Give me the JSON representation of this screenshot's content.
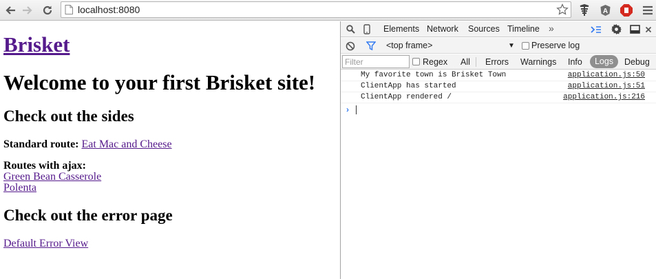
{
  "browser": {
    "url": "localhost:8080",
    "icons": [
      "back-icon",
      "forward-icon",
      "reload-icon",
      "page-icon",
      "star-icon",
      "extension-signal-icon",
      "extension-a-icon",
      "extension-stop-icon",
      "menu-icon"
    ]
  },
  "page": {
    "site_title": "Brisket",
    "welcome_heading": "Welcome to your first Brisket site!",
    "sides_heading": "Check out the sides",
    "standard_route_label": "Standard route:",
    "standard_route_link": "Eat Mac and Cheese",
    "ajax_label": "Routes with ajax:",
    "ajax_links": [
      "Green Bean Casserole",
      "Polenta"
    ],
    "error_heading": "Check out the error page",
    "error_link": "Default Error View",
    "link_color": "#551a8b"
  },
  "devtools": {
    "tabs": [
      "Elements",
      "Network",
      "Sources",
      "Timeline"
    ],
    "more_tabs": "»",
    "context": {
      "frame": "<top frame>",
      "preserve_log": "Preserve log"
    },
    "filter": {
      "placeholder": "Filter",
      "regex": "Regex",
      "levels": [
        "All",
        "Errors",
        "Warnings",
        "Info",
        "Logs",
        "Debug"
      ],
      "selected_level": "Logs"
    },
    "console_messages": [
      {
        "text": "My favorite town is Brisket Town",
        "source": "application.js:50"
      },
      {
        "text": "ClientApp has started",
        "source": "application.js:51"
      },
      {
        "text": "ClientApp rendered /",
        "source": "application.js:216"
      }
    ],
    "prompt_symbol": "›",
    "accent_color": "#367cf1"
  }
}
